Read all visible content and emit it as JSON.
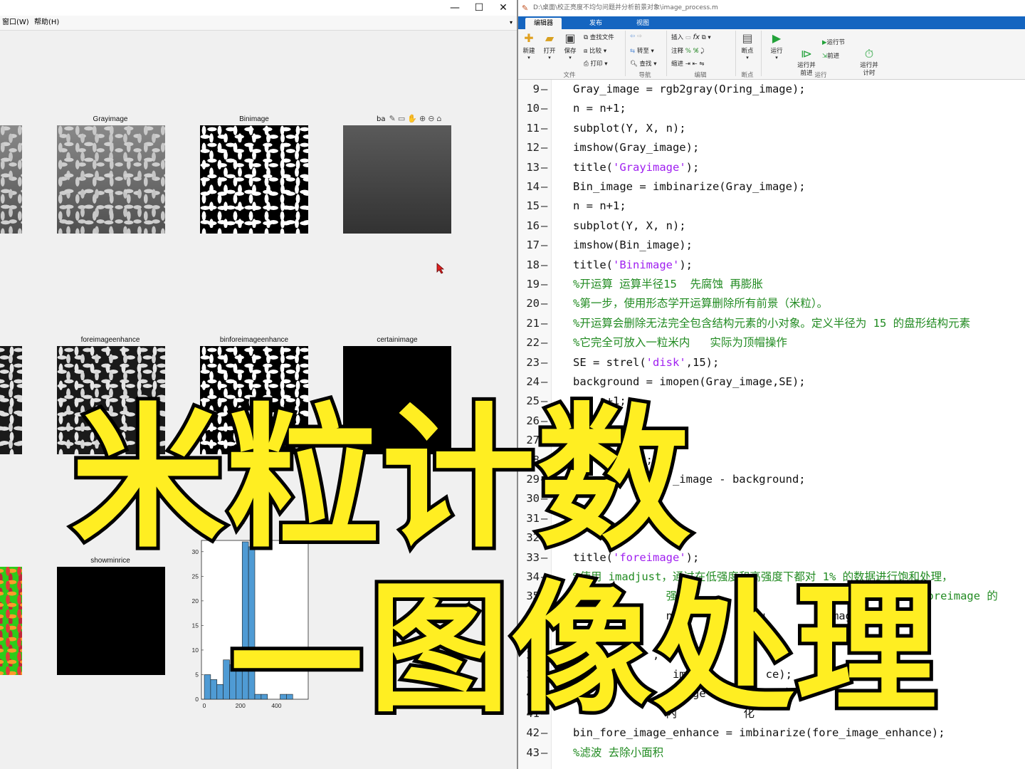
{
  "figure_window": {
    "controls": {
      "minimize": "—",
      "maximize": "☐",
      "close": "✕"
    },
    "menu": {
      "window": "窗口(W)",
      "help": "帮助(H)"
    },
    "subplot_titles": {
      "gray": "Grayimage",
      "bin": "Binimage",
      "background_partial": "ba",
      "fore_enhance": "foreimageenhance",
      "bin_fore_enhance": "binforeimageenhance",
      "certain": "certainimage",
      "show_min_rice": "showminrice"
    },
    "histogram": {
      "y_ticks": [
        "30",
        "25",
        "20",
        "15",
        "10",
        "5",
        "0"
      ],
      "x_ticks": [
        "0",
        "200",
        "400"
      ]
    }
  },
  "chart_data": {
    "type": "bar",
    "xlim": [
      0,
      560
    ],
    "ylim": [
      0,
      32
    ],
    "bin_width": 35,
    "x": [
      0,
      35,
      70,
      105,
      140,
      175,
      210,
      245,
      280,
      315,
      350,
      385,
      420,
      455,
      490,
      525
    ],
    "values": [
      5,
      4,
      3,
      8,
      7,
      8,
      32,
      31,
      1,
      1,
      0,
      0,
      1,
      1,
      0,
      0
    ],
    "bar_color": "#4f9bd4"
  },
  "editor": {
    "title": "D:\\桌面\\校正亮度不均匀问题并分析前景对象\\image_process.m",
    "tabs": [
      "编辑器",
      "发布",
      "视图"
    ],
    "ribbon": {
      "new": "新建",
      "open": "打开",
      "save": "保存",
      "find_files": "查找文件",
      "compare": "比较",
      "print": "打印",
      "goto": "转至",
      "find": "查找",
      "insert": "插入",
      "comment": "注释",
      "indent": "缩进",
      "breakpoint": "断点",
      "run": "运行",
      "run_advance": "运行并\n前进",
      "run_section": "运行节",
      "advance": "前进",
      "run_time": "运行并\n计时",
      "group_file": "文件",
      "group_nav": "导航",
      "group_edit": "编辑",
      "group_bp": "断点",
      "group_run": "运行"
    },
    "lines": [
      {
        "n": "9",
        "parts": [
          {
            "t": "Gray_image = rgb2gray(Oring_image);"
          }
        ]
      },
      {
        "n": "10",
        "parts": [
          {
            "t": "n = n+1;"
          }
        ]
      },
      {
        "n": "11",
        "parts": [
          {
            "t": "subplot(Y, X, n);"
          }
        ]
      },
      {
        "n": "12",
        "parts": [
          {
            "t": "imshow(Gray_image);"
          }
        ]
      },
      {
        "n": "13",
        "parts": [
          {
            "t": "title("
          },
          {
            "t": "'Grayimage'",
            "c": "str"
          },
          {
            "t": ");"
          }
        ]
      },
      {
        "n": "14",
        "parts": [
          {
            "t": "Bin_image = imbinarize(Gray_image);"
          }
        ]
      },
      {
        "n": "15",
        "parts": [
          {
            "t": "n = n+1;"
          }
        ]
      },
      {
        "n": "16",
        "parts": [
          {
            "t": "subplot(Y, X, n);"
          }
        ]
      },
      {
        "n": "17",
        "parts": [
          {
            "t": "imshow(Bin_image);"
          }
        ]
      },
      {
        "n": "18",
        "parts": [
          {
            "t": "title("
          },
          {
            "t": "'Binimage'",
            "c": "str"
          },
          {
            "t": ");"
          }
        ]
      },
      {
        "n": "19",
        "parts": [
          {
            "t": "%开运算 运算半径15  先腐蚀 再膨胀",
            "c": "cmt"
          }
        ]
      },
      {
        "n": "20",
        "parts": [
          {
            "t": "%第一步，使用形态学开运算删除所有前景（米粒）。",
            "c": "cmt"
          }
        ]
      },
      {
        "n": "21",
        "parts": [
          {
            "t": "%开运算会删除无法完全包含结构元素的小对象。定义半径为 15 的盘形结构元素",
            "c": "cmt"
          }
        ]
      },
      {
        "n": "22",
        "parts": [
          {
            "t": "%它完全可放入一粒米内   实际为顶帽操作",
            "c": "cmt"
          }
        ]
      },
      {
        "n": "23",
        "parts": [
          {
            "t": "SE = strel("
          },
          {
            "t": "'disk'",
            "c": "str"
          },
          {
            "t": ",15);"
          }
        ]
      },
      {
        "n": "24",
        "parts": [
          {
            "t": "background = imopen(Gray_image,SE);"
          }
        ]
      },
      {
        "n": "25",
        "parts": [
          {
            "t": "n = n+1;"
          }
        ]
      },
      {
        "n": "26",
        "parts": [
          {
            "t": ""
          }
        ]
      },
      {
        "n": "27",
        "parts": [
          {
            "t": ""
          }
        ]
      },
      {
        "n": "28",
        "parts": [
          {
            "t": "          );"
          }
        ]
      },
      {
        "n": "29",
        "parts": [
          {
            "t": "               _image - background;"
          }
        ]
      },
      {
        "n": "30",
        "parts": [
          {
            "t": ""
          }
        ]
      },
      {
        "n": "31",
        "parts": [
          {
            "t": ""
          }
        ]
      },
      {
        "n": "32",
        "parts": [
          {
            "t": "               ;"
          }
        ]
      },
      {
        "n": "33",
        "parts": [
          {
            "t": "title("
          },
          {
            "t": "'foreimage'",
            "c": "str"
          },
          {
            "t": ");"
          }
        ]
      },
      {
        "n": "34",
        "parts": [
          {
            "t": "%使用 imadjust，通过在低强度和高强度下都对 1% 的数据进行饱和处理，",
            "c": "cmt"
          }
        ]
      },
      {
        "n": "35",
        "parts": [
          {
            "t": "%             强度                   态范围            oreimage 的",
            "c": "cmt"
          }
        ]
      },
      {
        "n": "36",
        "parts": [
          {
            "t": "              nh     =      u         imag"
          }
        ]
      },
      {
        "n": "37",
        "parts": [
          {
            "t": ""
          }
        ]
      },
      {
        "n": "38",
        "parts": [
          {
            "t": "            , n"
          }
        ]
      },
      {
        "n": "39",
        "parts": [
          {
            "t": "               image         ce);"
          }
        ]
      },
      {
        "n": "40",
        "parts": [
          {
            "t": "               image"
          }
        ]
      },
      {
        "n": "41",
        "parts": [
          {
            "t": "              内          化"
          }
        ]
      },
      {
        "n": "42",
        "parts": [
          {
            "t": "bin_fore_image_enhance = imbinarize(fore_image_enhance);"
          }
        ]
      },
      {
        "n": "43",
        "parts": [
          {
            "t": "%滤波 去除小面积",
            "c": "cmt"
          }
        ]
      }
    ]
  },
  "overlay": {
    "line1": "米粒计数",
    "line2": "—图像处理",
    "fill_color": "#ffee22",
    "stroke_color": "#000000"
  }
}
